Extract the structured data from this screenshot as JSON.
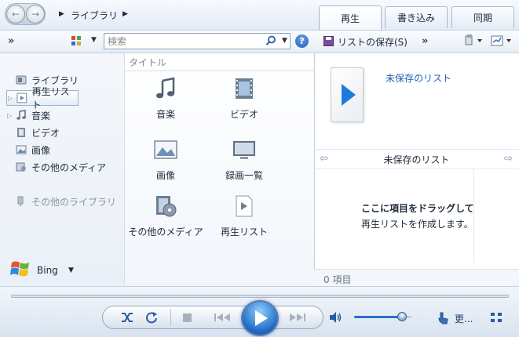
{
  "header": {
    "breadcrumb": [
      "ライブラリ"
    ],
    "tabs": [
      {
        "label": "再生",
        "active": true
      },
      {
        "label": "書き込み",
        "active": false
      },
      {
        "label": "同期",
        "active": false
      }
    ]
  },
  "toolbar": {
    "more_label": "»",
    "search_placeholder": "検索"
  },
  "nav": {
    "items": [
      {
        "label": "ライブラリ",
        "icon": "library-icon"
      },
      {
        "label": "再生リスト",
        "icon": "playlist-icon",
        "selected": true
      },
      {
        "label": "音楽",
        "icon": "music-icon"
      },
      {
        "label": "ビデオ",
        "icon": "video-icon"
      },
      {
        "label": "画像",
        "icon": "picture-icon"
      },
      {
        "label": "その他のメディア",
        "icon": "other-media-icon"
      }
    ],
    "other_libraries": "その他のライブラリ",
    "bing_label": "Bing"
  },
  "content": {
    "column_header": "タイトル",
    "tiles": [
      {
        "label": "音楽",
        "icon": "music-icon"
      },
      {
        "label": "ビデオ",
        "icon": "video-icon"
      },
      {
        "label": "画像",
        "icon": "picture-icon"
      },
      {
        "label": "録画一覧",
        "icon": "tv-icon"
      },
      {
        "label": "その他のメディア",
        "icon": "other-media-icon"
      },
      {
        "label": "再生リスト",
        "icon": "playlist-icon"
      }
    ]
  },
  "right_pane": {
    "save_list": "リストの保存(S)",
    "more_label": "»",
    "unsaved_title": "未保存のリスト",
    "list_name": "未保存のリスト",
    "drag_hint_bold": "ここに項目をドラッグして",
    "drag_hint": "再生リストを作成します。",
    "item_count": "0 項目"
  },
  "player": {
    "more_label": "更...",
    "volume_level": 0.85
  },
  "colors": {
    "accent": "#1f67c6",
    "link": "#1f5fb3"
  }
}
